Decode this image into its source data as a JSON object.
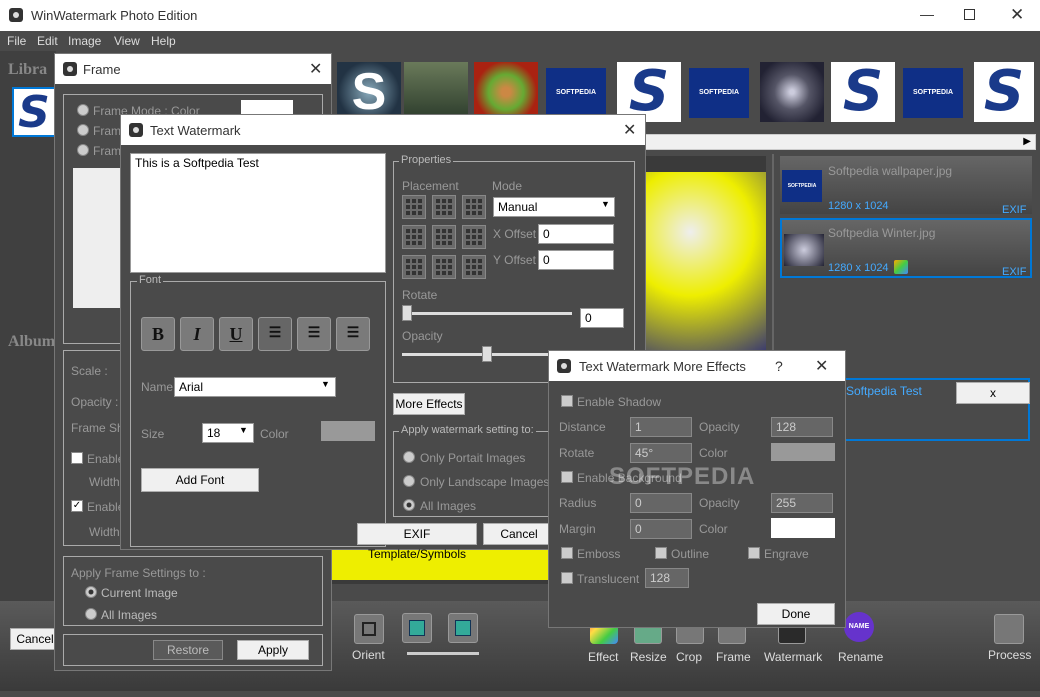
{
  "app": {
    "title": "WinWatermark Photo Edition",
    "menu": [
      "File",
      "Edit",
      "Image",
      "View",
      "Help"
    ],
    "library_label": "Libra",
    "album_label": "Album"
  },
  "frame": {
    "title": "Frame",
    "mode_label": "Frame Mode : Color",
    "radio2": "Frame",
    "radio3": "Frame",
    "scale": "Scale :",
    "opacity": "Opacity :",
    "frame_shape": "Frame Sha",
    "enable1": "Enable",
    "width1": "Width",
    "enable2": "Enable",
    "width2": "Width",
    "apply_to": "Apply Frame Settings to :",
    "current_image": "Current Image",
    "all_images": "All Images",
    "restore": "Restore",
    "apply": "Apply"
  },
  "text_watermark": {
    "title": "Text Watermark",
    "text": "This is a Softpedia Test",
    "font_group": "Font",
    "name_label": "Name",
    "font_name": "Arial",
    "size_label": "Size",
    "font_size": "18",
    "color_label": "Color",
    "add_font": "Add Font",
    "properties_group": "Properties",
    "placement_label": "Placement",
    "mode_label": "Mode",
    "mode_value": "Manual",
    "x_offset_label": "X Offset",
    "x_offset": "0",
    "y_offset_label": "Y Offset",
    "y_offset": "0",
    "rotate_label": "Rotate",
    "rotate": "0",
    "opacity_label": "Opacity",
    "more_effects": "More Effects",
    "apply_setting": "Apply watermark setting to:",
    "portrait": "Only Portait Images",
    "landscape": "Only Landscape Images",
    "all": "All Images",
    "exif": "EXIF Template/Symbols",
    "cancel": "Cancel",
    "bold": "B",
    "italic": "I",
    "underline": "U"
  },
  "more_effects": {
    "title": "Text Watermark More Effects",
    "help": "?",
    "enable_shadow": "Enable Shadow",
    "distance_label": "Distance",
    "distance": "1",
    "opacity_label": "Opacity",
    "opacity": "128",
    "rotate_label": "Rotate",
    "rotate": "45°",
    "color_label": "Color",
    "enable_background": "Enable Background",
    "radius_label": "Radius",
    "radius": "0",
    "opacity2": "255",
    "margin_label": "Margin",
    "margin": "0",
    "emboss": "Emboss",
    "outline": "Outline",
    "engrave": "Engrave",
    "translucent": "Translucent",
    "translucent_value": "128",
    "done": "Done",
    "watermark_text": "SOFTPEDIA"
  },
  "files": [
    {
      "name": "Softpedia wallpaper.jpg",
      "size": "1280 x 1024",
      "tag": "EXIF"
    },
    {
      "name": "Softpedia Winter.jpg",
      "size": "1280 x 1024",
      "tag": "EXIF"
    }
  ],
  "watermark_item": {
    "label": "Softpedia Test",
    "remove": "x"
  },
  "thumbs": {
    "softpedia": "SOFTPEDIA",
    "s": "S"
  },
  "toolbar": {
    "cancel": "Cancel",
    "orient": "Orient",
    "effect": "Effect",
    "resize": "Resize",
    "crop": "Crop",
    "frame": "Frame",
    "watermark": "Watermark",
    "rename": "Rename",
    "process": "Process",
    "rename_badge": "NAME"
  },
  "colors": {
    "accent": "#0078d7",
    "highlight": "#e8e800",
    "dark": "#4a4a4a"
  }
}
